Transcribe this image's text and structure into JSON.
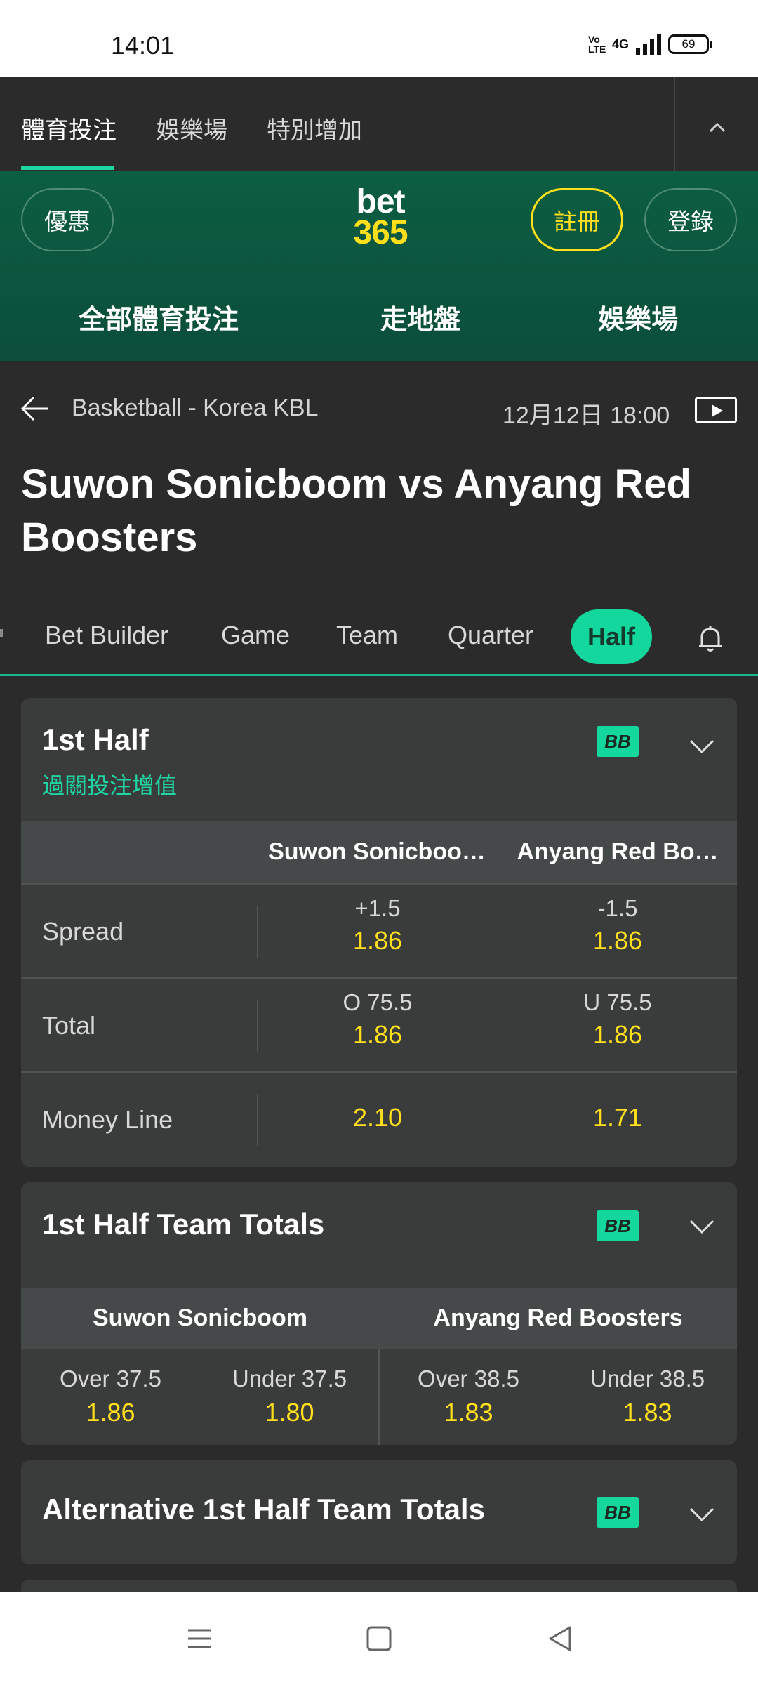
{
  "status": {
    "time": "14:01",
    "network": "4G",
    "volte": "Vo LTE",
    "battery": "69"
  },
  "top_tabs": [
    {
      "label": "體育投注",
      "active": true
    },
    {
      "label": "娛樂場",
      "active": false
    },
    {
      "label": "特別增加",
      "active": false
    }
  ],
  "header": {
    "promo_label": "優惠",
    "logo_line1": "bet",
    "logo_line2": "365",
    "register_label": "註冊",
    "login_label": "登錄",
    "nav": [
      "全部體育投注",
      "走地盤",
      "娛樂場"
    ]
  },
  "event": {
    "breadcrumb": "Basketball - Korea KBL",
    "datetime": "12月12日 18:00",
    "title": "Suwon Sonicboom vs Anyang Red Boosters"
  },
  "market_tabs": [
    {
      "label": "Bet Builder",
      "active": false
    },
    {
      "label": "Game",
      "active": false
    },
    {
      "label": "Team",
      "active": false
    },
    {
      "label": "Quarter",
      "active": false
    },
    {
      "label": "Half",
      "active": true
    }
  ],
  "first_half": {
    "title": "1st Half",
    "subtitle": "過關投注增值",
    "bb": "BB",
    "col_home": "Suwon Sonicboo…",
    "col_away": "Anyang Red Bo…",
    "rows": [
      {
        "label": "Spread",
        "home_line": "+1.5",
        "home_odds": "1.86",
        "away_line": "-1.5",
        "away_odds": "1.86"
      },
      {
        "label": "Total",
        "home_line": "O 75.5",
        "home_odds": "1.86",
        "away_line": "U 75.5",
        "away_odds": "1.86"
      },
      {
        "label": "Money Line",
        "home_line": "",
        "home_odds": "2.10",
        "away_line": "",
        "away_odds": "1.71"
      }
    ]
  },
  "team_totals": {
    "title": "1st Half Team Totals",
    "bb": "BB",
    "home_team": "Suwon Sonicboom",
    "away_team": "Anyang Red Boosters",
    "cells": [
      {
        "line": "Over 37.5",
        "odds": "1.86"
      },
      {
        "line": "Under 37.5",
        "odds": "1.80"
      },
      {
        "line": "Over 38.5",
        "odds": "1.83"
      },
      {
        "line": "Under 38.5",
        "odds": "1.83"
      }
    ]
  },
  "alt_team_totals": {
    "title": "Alternative 1st Half Team Totals",
    "bb": "BB"
  },
  "colors": {
    "accent": "#14d79e",
    "odds": "#ffdf1b",
    "brand_green": "#0c5e43",
    "background": "#2b2b2b",
    "card": "#3a3c3c"
  },
  "icons": [
    "back-arrow-icon",
    "play-icon",
    "bell-icon",
    "chevron-down-icon",
    "chevron-up-icon",
    "menu-icon",
    "home-square-icon",
    "back-triangle-icon"
  ]
}
